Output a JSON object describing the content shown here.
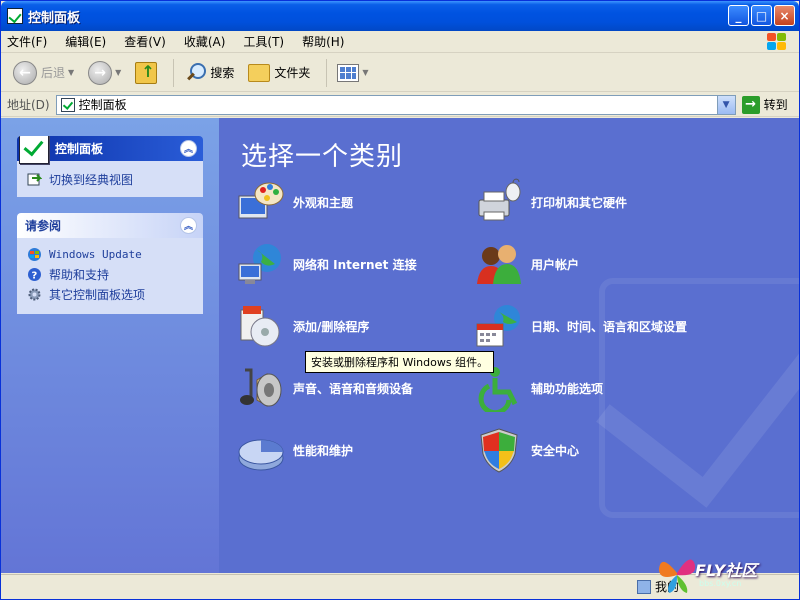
{
  "window": {
    "title": "控制面板",
    "min_label": "_",
    "max_label": "□",
    "close_label": "×"
  },
  "menubar": {
    "items": [
      "文件(F)",
      "编辑(E)",
      "查看(V)",
      "收藏(A)",
      "工具(T)",
      "帮助(H)"
    ]
  },
  "toolbar": {
    "back_label": "后退",
    "search_label": "搜索",
    "folders_label": "文件夹"
  },
  "address": {
    "label": "地址(D)",
    "value": "控制面板",
    "go_label": "转到"
  },
  "tasks": {
    "control_panel": {
      "title": "控制面板",
      "link": "切换到经典视图"
    },
    "see_also": {
      "title": "请参阅",
      "items": [
        "Windows Update",
        "帮助和支持",
        "其它控制面板选项"
      ]
    }
  },
  "main": {
    "title": "选择一个类别",
    "categories": [
      {
        "label": "外观和主题",
        "icon": "appearance-icon"
      },
      {
        "label": "打印机和其它硬件",
        "icon": "printer-icon"
      },
      {
        "label": "网络和 Internet 连接",
        "icon": "network-icon"
      },
      {
        "label": "用户帐户",
        "icon": "users-icon"
      },
      {
        "label": "添加/删除程序",
        "icon": "add-remove-icon"
      },
      {
        "label": "日期、时间、语言和区域设置",
        "icon": "datetime-icon"
      },
      {
        "label": "声音、语音和音频设备",
        "icon": "sound-icon"
      },
      {
        "label": "辅助功能选项",
        "icon": "accessibility-icon"
      },
      {
        "label": "性能和维护",
        "icon": "performance-icon"
      },
      {
        "label": "安全中心",
        "icon": "security-shield-icon"
      }
    ],
    "tooltip": "安装或删除程序和 Windows 组件。"
  },
  "statusbar": {
    "zone": "我的",
    "forum_name": "FLY社区",
    "forum_url": "bbs.0xy.cn"
  },
  "colors": {
    "titlebar": "#0053e1",
    "content_bg": "#6375d6",
    "panel_body": "#d6dff7",
    "link": "#1f3f9c"
  }
}
